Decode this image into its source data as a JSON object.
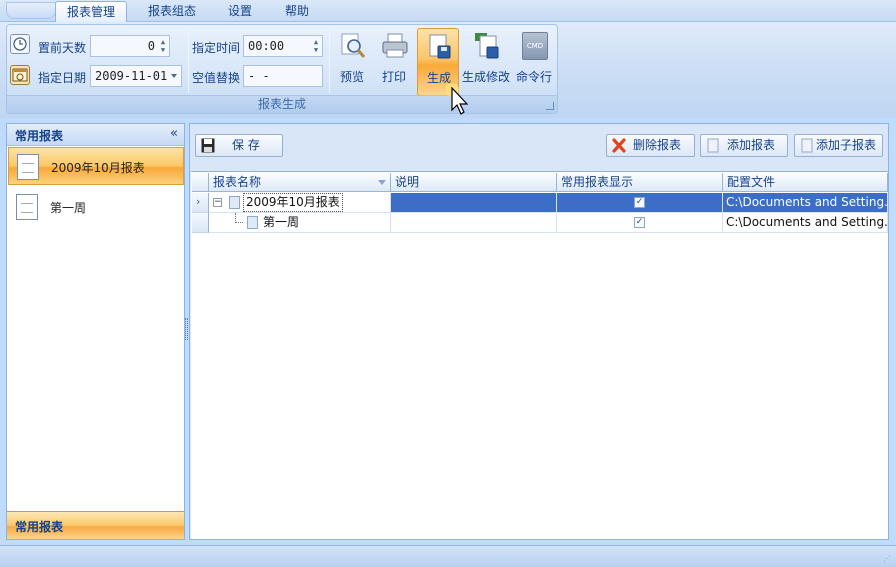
{
  "ribbon": {
    "tabs": [
      {
        "label": "报表管理",
        "active": true
      },
      {
        "label": "报表组态",
        "active": false
      },
      {
        "label": "设置",
        "active": false
      },
      {
        "label": "帮助",
        "active": false
      }
    ],
    "group_caption": "报表生成",
    "fields": {
      "advance_days_label": "置前天数",
      "advance_days_value": "0",
      "date_label": "指定日期",
      "date_value": "2009-11-01",
      "time_label": "指定时间",
      "time_value": "00:00",
      "null_replace_label": "空值替换",
      "null_replace_value": "- -"
    },
    "buttons": [
      {
        "label": "预览",
        "icon": "magnifier-icon"
      },
      {
        "label": "打印",
        "icon": "printer-icon"
      },
      {
        "label": "生成",
        "icon": "generate-doc-icon"
      },
      {
        "label": "生成修改",
        "icon": "generate-modify-icon"
      },
      {
        "label": "命令行",
        "icon": "cmd-icon",
        "icon_text": "CMD"
      }
    ]
  },
  "left_panel": {
    "title": "常用报表",
    "items": [
      {
        "label": "2009年10月报表",
        "selected": true
      },
      {
        "label": "第一周",
        "selected": false
      }
    ],
    "footer": "常用报表"
  },
  "toolbar": {
    "save_label": "保  存",
    "delete_label": "删除报表",
    "add_label": "添加报表",
    "add_child_label": "添加子报表"
  },
  "grid": {
    "columns": [
      "报表名称",
      "说明",
      "常用报表显示",
      "配置文件"
    ],
    "rows": [
      {
        "name": "2009年10月报表",
        "desc": "",
        "show": "✓",
        "config": "C:\\Documents and Setting...",
        "selected": true
      },
      {
        "name": "第一周",
        "desc": "",
        "show": "✓",
        "config": "C:\\Documents and Setting...",
        "selected": false
      }
    ]
  },
  "colors": {
    "accent_orange": "#f9a93a",
    "selection_blue": "#3c6ec5",
    "ribbon_blue": "#bfdbff"
  }
}
